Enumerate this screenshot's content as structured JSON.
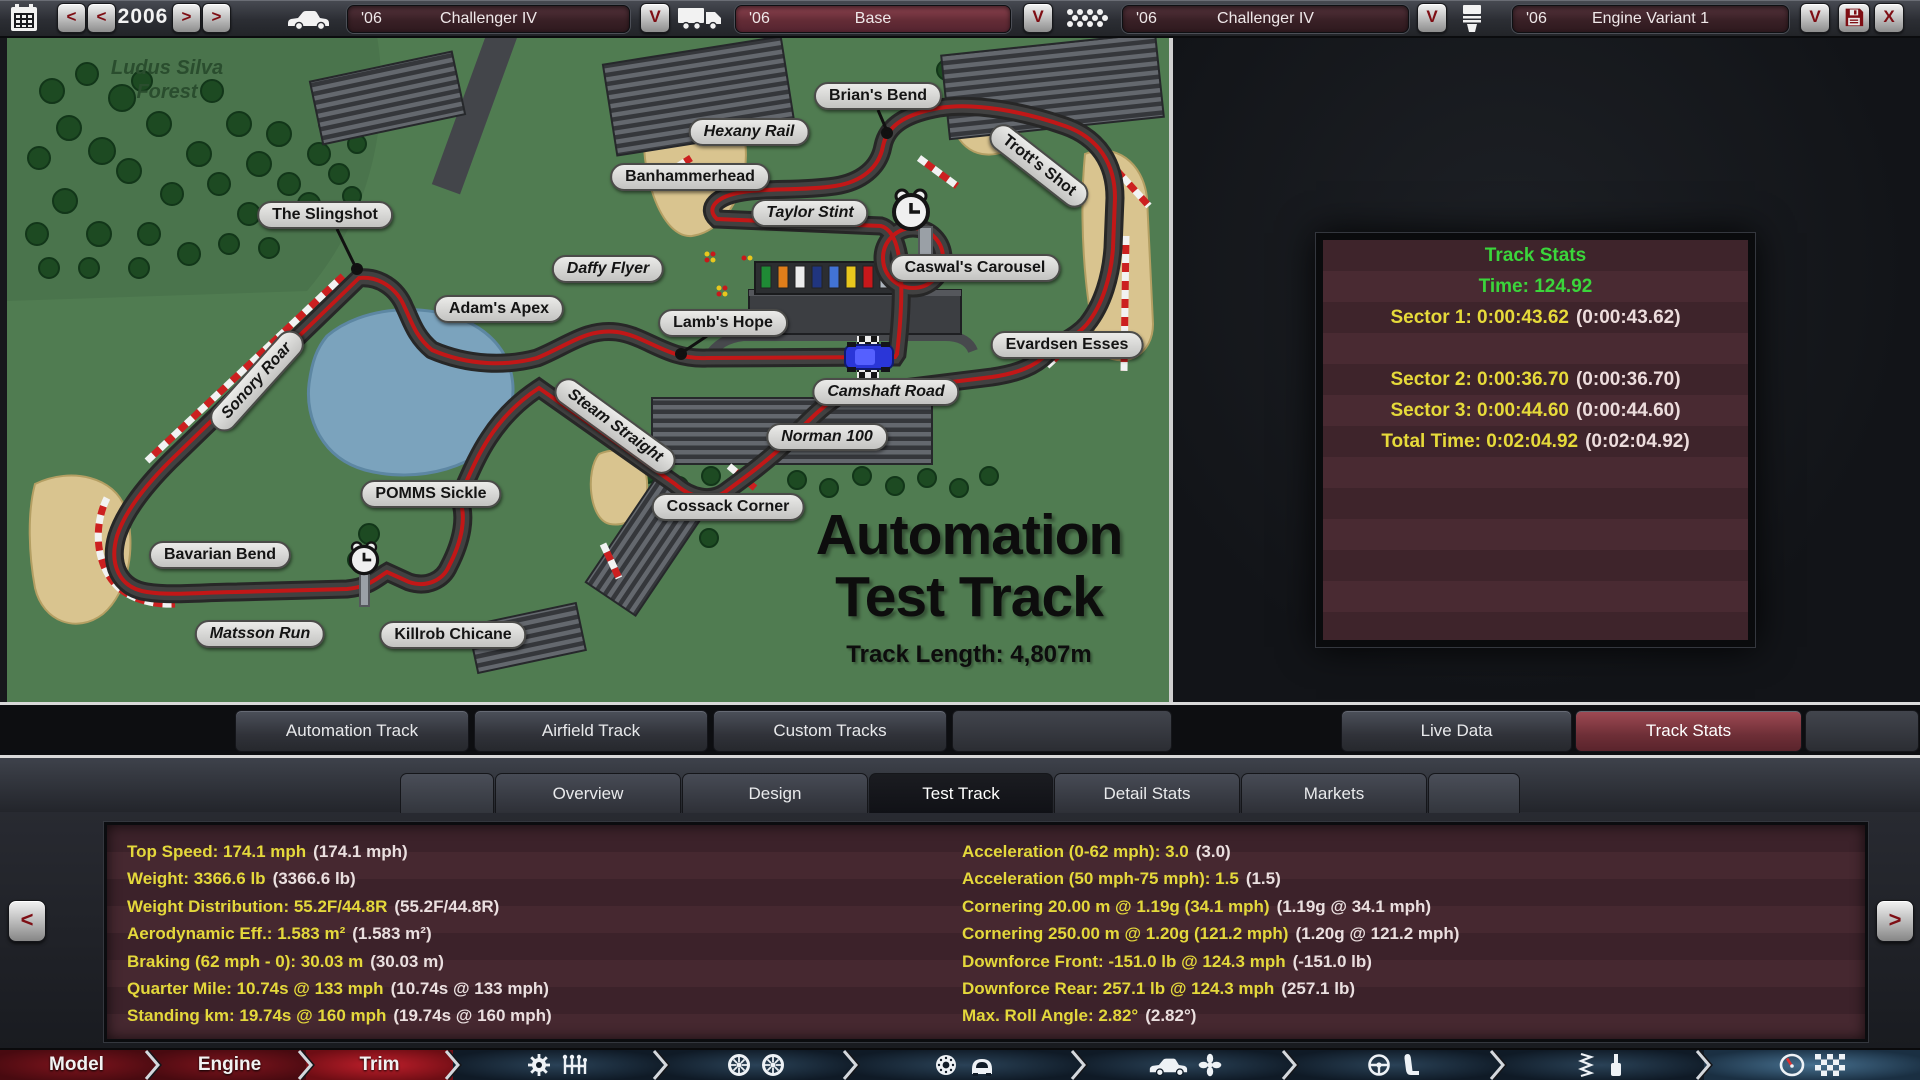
{
  "top_bar": {
    "year": "2006",
    "prev_fast": "<",
    "prev": "<",
    "next": ">",
    "next_fast": ">",
    "dropdown_arrow": "V",
    "save_label": "save-icon",
    "close_label": "X",
    "selectors": [
      {
        "name": "model",
        "icon": "car-icon",
        "prefix": "'06",
        "value": "Challenger IV"
      },
      {
        "name": "trim",
        "icon": "truck-icon",
        "prefix": "'06",
        "value": "Base",
        "highlighted": true
      },
      {
        "name": "engine-family",
        "icon": "engine-icon",
        "prefix": "'06",
        "value": "Challenger IV"
      },
      {
        "name": "engine-variant",
        "icon": "piston-icon",
        "prefix": "'06",
        "value": "Engine Variant 1"
      }
    ]
  },
  "map": {
    "forest_line1": "Ludus Silva",
    "forest_line2": "Forest",
    "title1": "Automation",
    "title2": "Test Track",
    "length": "Track Length: 4,807m",
    "corners": [
      {
        "id": "brians-bend",
        "label": "Brian's Bend"
      },
      {
        "id": "hexany-rail",
        "label": "Hexany Rail"
      },
      {
        "id": "trotts-shot",
        "label": "Trott's Shot"
      },
      {
        "id": "banhammerhead",
        "label": "Banhammerhead"
      },
      {
        "id": "taylor-stint",
        "label": "Taylor Stint"
      },
      {
        "id": "the-slingshot",
        "label": "The Slingshot"
      },
      {
        "id": "caswals-carousel",
        "label": "Caswal's Carousel"
      },
      {
        "id": "daffy-flyer",
        "label": "Daffy Flyer"
      },
      {
        "id": "adams-apex",
        "label": "Adam's Apex"
      },
      {
        "id": "lambs-hope",
        "label": "Lamb's Hope"
      },
      {
        "id": "evardsen-esses",
        "label": "Evardsen Esses"
      },
      {
        "id": "camshaft-road",
        "label": "Camshaft Road"
      },
      {
        "id": "sonory-roar",
        "label": "Sonory Roar"
      },
      {
        "id": "steam-straight",
        "label": "Steam Straight"
      },
      {
        "id": "norman-100",
        "label": "Norman 100"
      },
      {
        "id": "pomms-sickle",
        "label": "POMMS Sickle"
      },
      {
        "id": "cossack-corner",
        "label": "Cossack Corner"
      },
      {
        "id": "bavarian-bend",
        "label": "Bavarian Bend"
      },
      {
        "id": "matsson-run",
        "label": "Matsson Run"
      },
      {
        "id": "killrob-chicane",
        "label": "Killrob Chicane"
      }
    ]
  },
  "track_tabs": [
    {
      "label": "Automation Track"
    },
    {
      "label": "Airfield Track"
    },
    {
      "label": "Custom Tracks"
    }
  ],
  "stats_tabs": [
    {
      "label": "Live Data"
    },
    {
      "label": "Track Stats",
      "selected": true
    }
  ],
  "track_stats": {
    "title": "Track Stats",
    "time": "Time: 124.92",
    "rows": [
      {
        "main": "Sector 1: 0:00:43.62",
        "paren": "(0:00:43.62)"
      },
      {
        "main": "Sector 2: 0:00:36.70",
        "paren": "(0:00:36.70)"
      },
      {
        "main": "Sector 3: 0:00:44.60",
        "paren": "(0:00:44.60)"
      },
      {
        "main": "Total Time: 0:02:04.92",
        "paren": "(0:02:04.92)"
      }
    ]
  },
  "main_tabs": [
    {
      "label": "Overview"
    },
    {
      "label": "Design"
    },
    {
      "label": "Test Track",
      "selected": true
    },
    {
      "label": "Detail Stats"
    },
    {
      "label": "Markets"
    }
  ],
  "performance": {
    "prev": "<",
    "next": ">",
    "left": [
      {
        "main": "Top Speed: 174.1 mph",
        "paren": "(174.1 mph)"
      },
      {
        "main": "Weight: 3366.6 lb",
        "paren": "(3366.6 lb)"
      },
      {
        "main": "Weight Distribution: 55.2F/44.8R",
        "paren": "(55.2F/44.8R)"
      },
      {
        "main": "Aerodynamic Eff.: 1.583 m²",
        "paren": "(1.583 m²)"
      },
      {
        "main": "Braking (62 mph - 0): 30.03 m",
        "paren": "(30.03 m)"
      },
      {
        "main": "Quarter Mile: 10.74s @ 133 mph",
        "paren": "(10.74s @ 133 mph)"
      },
      {
        "main": "Standing km: 19.74s @ 160 mph",
        "paren": "(19.74s @ 160 mph)"
      }
    ],
    "right": [
      {
        "main": "Acceleration (0-62 mph): 3.0",
        "paren": "(3.0)"
      },
      {
        "main": "Acceleration (50 mph-75 mph): 1.5",
        "paren": "(1.5)"
      },
      {
        "main": "Cornering 20.00 m @ 1.19g (34.1 mph)",
        "paren": "(1.19g @ 34.1 mph)"
      },
      {
        "main": "Cornering 250.00 m @ 1.20g (121.2 mph)",
        "paren": "(1.20g @ 121.2 mph)"
      },
      {
        "main": "Downforce Front: -151.0 lb @ 124.3 mph",
        "paren": "(-151.0 lb)"
      },
      {
        "main": "Downforce Rear: 257.1 lb @ 124.3 mph",
        "paren": "(257.1 lb)"
      },
      {
        "main": "Max. Roll Angle: 2.82°",
        "paren": "(2.82°)"
      }
    ]
  },
  "bottom_nav": {
    "labels": [
      "Model",
      "Engine",
      "Trim"
    ],
    "icon_sections": [
      "drivetrain",
      "wheels",
      "brakes",
      "body-aero",
      "interior",
      "suspension",
      "test-track"
    ]
  },
  "colors": {
    "accent_red": "#7e0e14",
    "stat_yellow": "#e4d83b",
    "stat_white": "#eadfdf",
    "stats_green": "#3bd53b",
    "grass_green": "#507c51"
  }
}
